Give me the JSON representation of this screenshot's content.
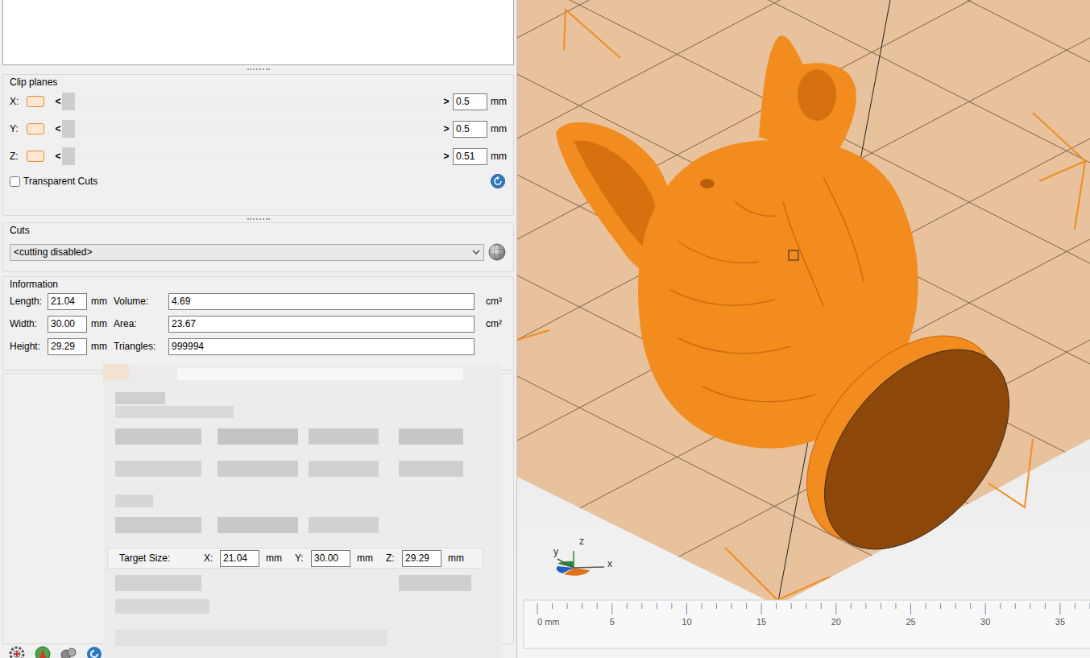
{
  "clip_planes": {
    "title": "Clip planes",
    "rows": [
      {
        "axis": "X:",
        "left": "<",
        "right": ">",
        "value": "0.5",
        "unit": "mm",
        "level": 0
      },
      {
        "axis": "Y:",
        "left": "<",
        "right": ">",
        "value": "0.5",
        "unit": "mm",
        "level": 0
      },
      {
        "axis": "Z:",
        "left": "<",
        "right": ">",
        "value": "0.51",
        "unit": "mm",
        "level": 0
      }
    ],
    "transparent_cuts": {
      "label": "Transparent Cuts",
      "checked": false
    }
  },
  "cuts": {
    "title": "Cuts",
    "dropdown": "<cutting disabled>"
  },
  "information": {
    "title": "Information",
    "dimensions": [
      {
        "label": "Length:",
        "value": "21.04",
        "unit": "mm"
      },
      {
        "label": "Width:",
        "value": "30.00",
        "unit": "mm"
      },
      {
        "label": "Height:",
        "value": "29.29",
        "unit": "mm"
      }
    ],
    "properties": [
      {
        "label": "Volume:",
        "value": "4.69",
        "unit": "cm³"
      },
      {
        "label": "Area:",
        "value": "23.67",
        "unit": "cm²"
      },
      {
        "label": "Triangles:",
        "value": "999994"
      }
    ]
  },
  "scale_dialog": {
    "label": "Target Size:",
    "axes": [
      {
        "axis": "X:",
        "value": "21.04",
        "unit": "mm"
      },
      {
        "axis": "Y:",
        "value": "30.00",
        "unit": "mm"
      },
      {
        "axis": "Z:",
        "value": "29.29",
        "unit": "mm"
      }
    ]
  },
  "viewport": {
    "axes": [
      {
        "label": "y"
      },
      {
        "label": "z"
      },
      {
        "label": "x"
      }
    ],
    "ruler": [
      "0 mm",
      "5",
      "10",
      "15",
      "20",
      "25",
      "30",
      "35"
    ]
  }
}
